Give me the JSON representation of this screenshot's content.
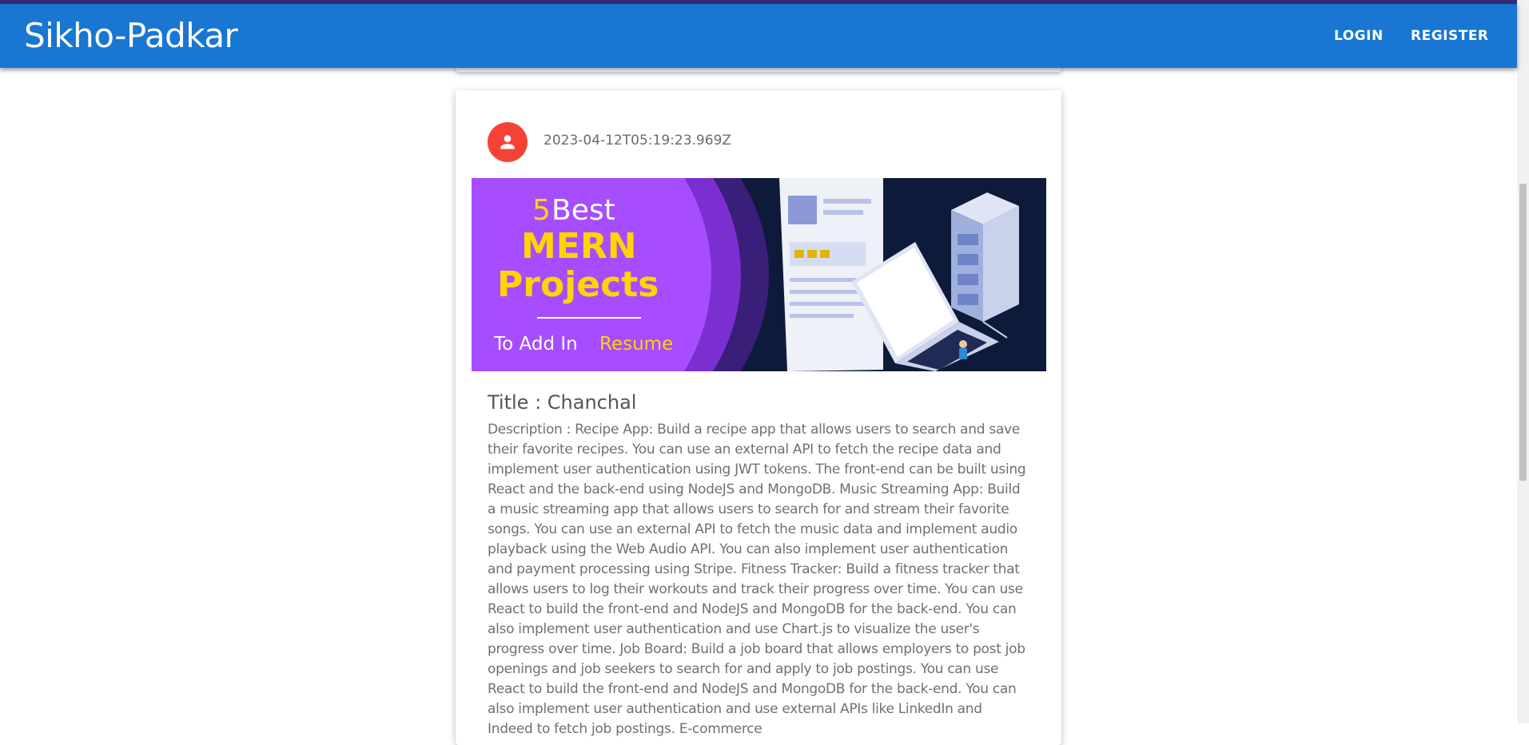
{
  "app": {
    "title": "Sikho-Padkar",
    "nav": {
      "login": "LOGIN",
      "register": "REGISTER"
    }
  },
  "post": {
    "timestamp": "2023-04-12T05:19:23.969Z",
    "title": "Title : Chanchal",
    "description": "Description : Recipe App: Build a recipe app that allows users to search and save their favorite recipes. You can use an external API to fetch the recipe data and implement user authentication using JWT tokens. The front-end can be built using React and the back-end using NodeJS and MongoDB. Music Streaming App: Build a music streaming app that allows users to search for and stream their favorite songs. You can use an external API to fetch the music data and implement audio playback using the Web Audio API. You can also implement user authentication and payment processing using Stripe. Fitness Tracker: Build a fitness tracker that allows users to log their workouts and track their progress over time. You can use React to build the front-end and NodeJS and MongoDB for the back-end. You can also implement user authentication and use Chart.js to visualize the user's progress over time. Job Board: Build a job board that allows employers to post job openings and job seekers to search for and apply to job postings. You can use React to build the front-end and NodeJS and MongoDB for the back-end. You can also implement user authentication and use external APIs like LinkedIn and Indeed to fetch job postings. E-commerce",
    "image": {
      "line1_number": "5",
      "line1_word": "Best",
      "line2": "MERN",
      "line3": "Projects",
      "tagline_a": "To Add In",
      "tagline_b": "Resume"
    }
  },
  "colors": {
    "appbar": "#1976d2",
    "avatar": "#f44336",
    "image_purple": "#a64dff",
    "image_dark": "#0e1a3a",
    "image_yellow": "#ffd400"
  },
  "icons": {
    "avatar": "person-icon"
  }
}
